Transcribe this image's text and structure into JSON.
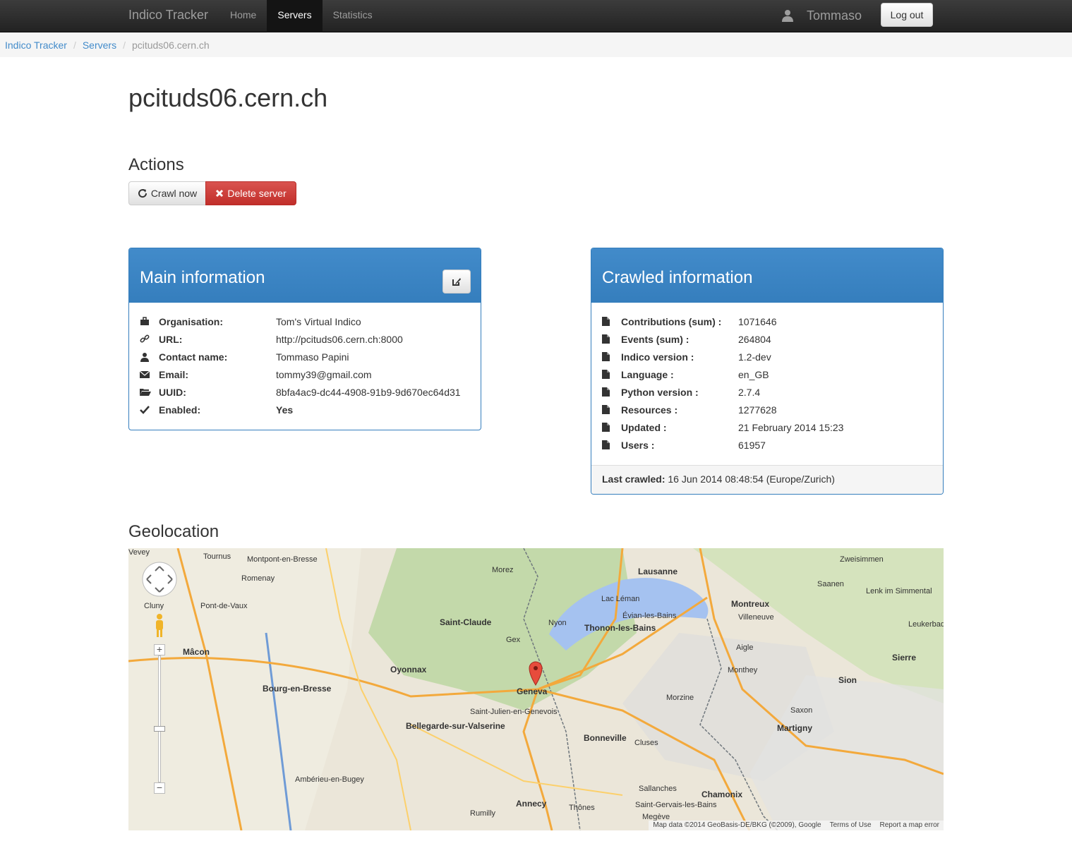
{
  "navbar": {
    "brand": "Indico Tracker",
    "items": [
      "Home",
      "Servers",
      "Statistics"
    ],
    "active": "Servers",
    "user": "Tommaso",
    "logout_label": "Log out"
  },
  "breadcrumb": {
    "items": [
      "Indico Tracker",
      "Servers"
    ],
    "current": "pcituds06.cern.ch"
  },
  "page": {
    "title": "pcituds06.cern.ch",
    "actions_heading": "Actions",
    "crawl_label": "Crawl now",
    "delete_label": "Delete server",
    "geolocation_heading": "Geolocation"
  },
  "main_info": {
    "title": "Main information",
    "rows": [
      {
        "label": "Organisation:",
        "value": "Tom's Virtual Indico",
        "icon": "briefcase-icon"
      },
      {
        "label": "URL:",
        "value": "http://pcituds06.cern.ch:8000",
        "icon": "link-icon"
      },
      {
        "label": "Contact name:",
        "value": "Tommaso Papini",
        "icon": "user-icon"
      },
      {
        "label": "Email:",
        "value": "tommy39@gmail.com",
        "icon": "envelope-icon"
      },
      {
        "label": "UUID:",
        "value": "8bfa4ac9-dc44-4908-91b9-9d670ec64d31",
        "icon": "folder-open-icon"
      },
      {
        "label": "Enabled:",
        "value": "Yes",
        "icon": "check-icon"
      }
    ]
  },
  "crawled_info": {
    "title": "Crawled information",
    "rows": [
      {
        "label": "Contributions (sum) :",
        "value": "1071646"
      },
      {
        "label": "Events (sum) :",
        "value": "264804"
      },
      {
        "label": "Indico version :",
        "value": "1.2-dev"
      },
      {
        "label": "Language :",
        "value": "en_GB"
      },
      {
        "label": "Python version :",
        "value": "2.7.4"
      },
      {
        "label": "Resources :",
        "value": "1277628"
      },
      {
        "label": "Updated :",
        "value": "21 February 2014 15:23"
      },
      {
        "label": "Users :",
        "value": "61957"
      }
    ],
    "last_crawled_label": "Last crawled:",
    "last_crawled_value": "16 Jun 2014 08:48:54 (Europe/Zurich)"
  },
  "map": {
    "labels": [
      "Lausanne",
      "Montreux",
      "Geneva",
      "Thonon-les-Bains",
      "Évian-les-Bains",
      "Annecy",
      "Chamonix",
      "Sion",
      "Mâcon",
      "Bourg-en-Bresse",
      "Oyonnax",
      "Morzine",
      "Martigny",
      "Nyon",
      "Gex",
      "Bellegarde-sur-Valserine",
      "Saint-Julien-en-Genevois",
      "Bonneville",
      "Cluses",
      "Sallanches",
      "Lac Léman",
      "Aigle",
      "Monthey",
      "Villeneuve",
      "Vevey",
      "Morez",
      "Saint-Claude",
      "Pont-de-Vaux",
      "Cluny",
      "Saxon",
      "Saanen",
      "Lenk im Simmental",
      "Leukerbad",
      "Sierre",
      "Zweisimmen",
      "Tournus",
      "Montpont-en-Bresse",
      "Romenay",
      "Ambérieu-en-Bugey",
      "Rumilly",
      "Thônes",
      "Saint-Gervais-les-Bains",
      "Megève"
    ],
    "attribution": "Map data ©2014 GeoBasis-DE/BKG (©2009), Google",
    "terms": "Terms of Use",
    "report": "Report a map error"
  },
  "colors": {
    "navbar": "#222222",
    "primary": "#428bca",
    "danger": "#d9534f",
    "success": "#3c763d"
  }
}
